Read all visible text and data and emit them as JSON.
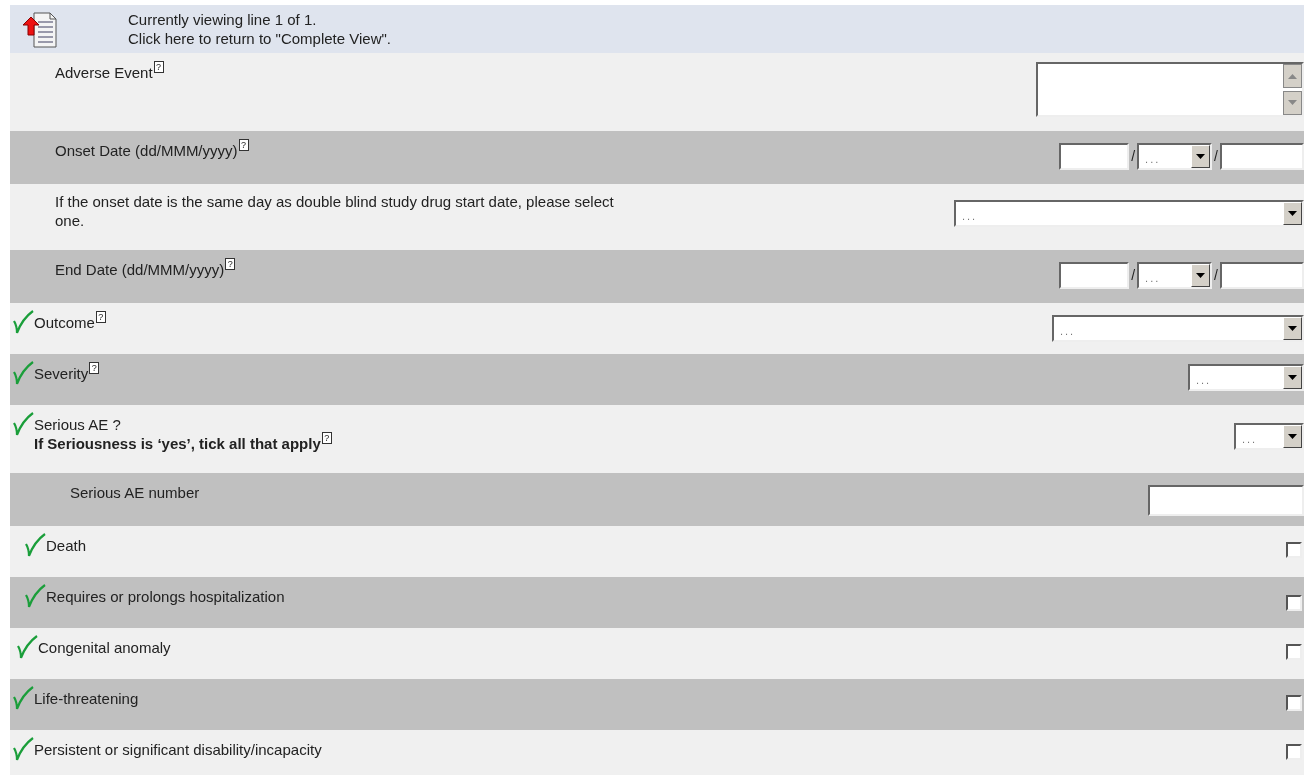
{
  "header": {
    "line1": "Currently viewing line 1 of 1.",
    "line2": "Click here to return to \"Complete View\"."
  },
  "help_mark": "?",
  "rows": [
    {
      "kind": "textarea",
      "label": "Adverse Event",
      "help": true,
      "verified": false
    },
    {
      "kind": "date",
      "label": "Onset Date (dd/MMM/yyyy)",
      "help": true,
      "verified": false,
      "separator": "/",
      "month": "..."
    },
    {
      "kind": "select",
      "label": "If the onset date is the same day as double blind study drug start date, please select one.",
      "help": false,
      "verified": false,
      "value": "..."
    },
    {
      "kind": "date",
      "label": "End Date (dd/MMM/yyyy)",
      "help": true,
      "verified": false,
      "separator": "/",
      "month": "..."
    },
    {
      "kind": "select",
      "label": "Outcome",
      "help": true,
      "verified": true,
      "value": "..."
    },
    {
      "kind": "select",
      "label": "Severity",
      "help": true,
      "verified": true,
      "value": "..."
    },
    {
      "kind": "select",
      "label": "Serious AE ?",
      "note": "If Seriousness is ‘yes’, tick all that apply",
      "help": true,
      "verified": true,
      "value": "..."
    },
    {
      "kind": "text",
      "label": "Serious AE number",
      "help": false,
      "verified": false
    },
    {
      "kind": "checkbox",
      "label": "Death",
      "help": false,
      "verified": true,
      "checked": false
    },
    {
      "kind": "checkbox",
      "label": "Requires or prolongs hospitalization",
      "help": false,
      "verified": true,
      "checked": false
    },
    {
      "kind": "checkbox",
      "label": "Congenital anomaly",
      "help": false,
      "verified": true,
      "checked": false
    },
    {
      "kind": "checkbox",
      "label": "Life-threatening",
      "help": false,
      "verified": true,
      "checked": false
    },
    {
      "kind": "checkbox",
      "label": "Persistent or significant disability/incapacity",
      "help": false,
      "verified": true,
      "checked": false
    }
  ]
}
